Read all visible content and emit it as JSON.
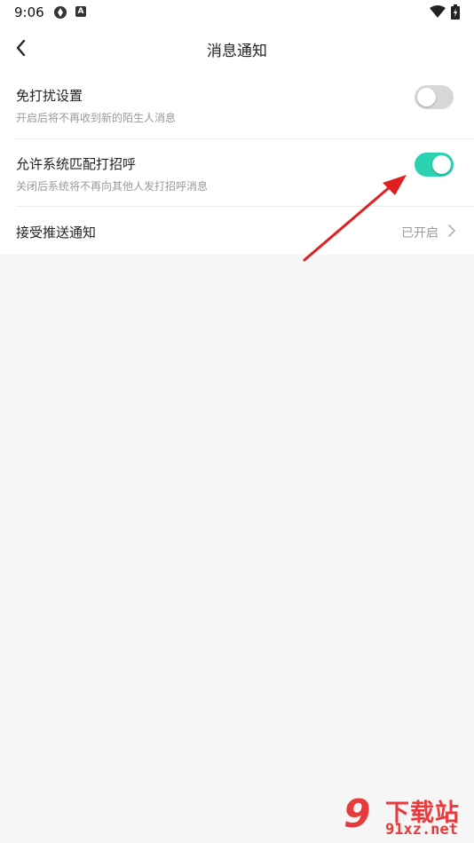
{
  "status_bar": {
    "time": "9:06",
    "icons": [
      "aperture-icon",
      "a-box-icon",
      "wifi-icon",
      "battery-charging-icon"
    ]
  },
  "header": {
    "title": "消息通知",
    "back_icon": "chevron-left-icon"
  },
  "settings": [
    {
      "label": "免打扰设置",
      "subtitle": "开启后将不再收到新的陌生人消息",
      "control": "toggle",
      "enabled": false
    },
    {
      "label": "允许系统匹配打招呼",
      "subtitle": "关闭后系统将不再向其他人发打招呼消息",
      "control": "toggle",
      "enabled": true
    },
    {
      "label": "接受推送通知",
      "value": "已开启",
      "control": "link"
    }
  ],
  "colors": {
    "toggle_on": "#2bd2b0",
    "toggle_off": "#d7d7d7",
    "annotation_arrow": "#e02020",
    "watermark": "#e83a3a"
  },
  "watermark": {
    "logo": "9",
    "brand": "下载站",
    "site": "91xz.net"
  }
}
